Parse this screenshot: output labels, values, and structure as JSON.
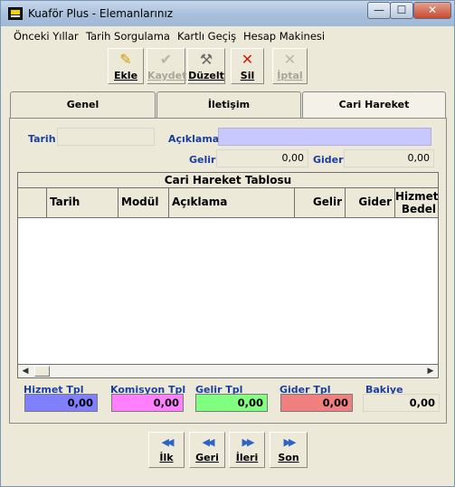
{
  "window": {
    "title": "Kuaför Plus - Elemanlarınız",
    "min": "—",
    "max": "☐",
    "close": "✕"
  },
  "menu": [
    "Önceki Yıllar",
    "Tarih Sorgulama",
    "Kartlı Geçiş",
    "Hesap Makinesi"
  ],
  "toolbar": {
    "ekle": "Ekle",
    "kaydet": "Kaydet",
    "duzelt": "Düzelt",
    "sil": "Sil",
    "iptal": "İptal"
  },
  "tabs": [
    "Genel",
    "İletişim",
    "Cari Hareket"
  ],
  "form": {
    "tarih_label": "Tarih",
    "tarih_value": "",
    "aciklama_label": "Açıklama",
    "aciklama_value": "",
    "gelir_label": "Gelir",
    "gelir_value": "0,00",
    "gider_label": "Gider",
    "gider_value": "0,00"
  },
  "table": {
    "title": "Cari Hareket Tablosu",
    "columns": [
      "",
      "Tarih",
      "Modül",
      "Açıklama",
      "Gelir",
      "Gider",
      "Hizmet Bedel"
    ],
    "rows": []
  },
  "totals": {
    "hizmet_label": "Hizmet Tpl",
    "hizmet_value": "0,00",
    "komisyon_label": "Komisyon Tpl",
    "komisyon_value": "0,00",
    "gelir_label": "Gelir Tpl",
    "gelir_value": "0,00",
    "gider_label": "Gider Tpl",
    "gider_value": "0,00",
    "bakiye_label": "Bakiye",
    "bakiye_value": "0,00"
  },
  "nav": {
    "ilk": "İlk",
    "geri": "Geri",
    "ileri": "İleri",
    "son": "Son"
  },
  "colors": {
    "hizmet": "#8080ff",
    "komisyon": "#ff80ff",
    "gelir": "#80ff80",
    "gider": "#f08080",
    "aciklama_field": "#c8c8ff",
    "label_blue": "#1b3fa0",
    "nav_arrow": "#2c63c8"
  }
}
